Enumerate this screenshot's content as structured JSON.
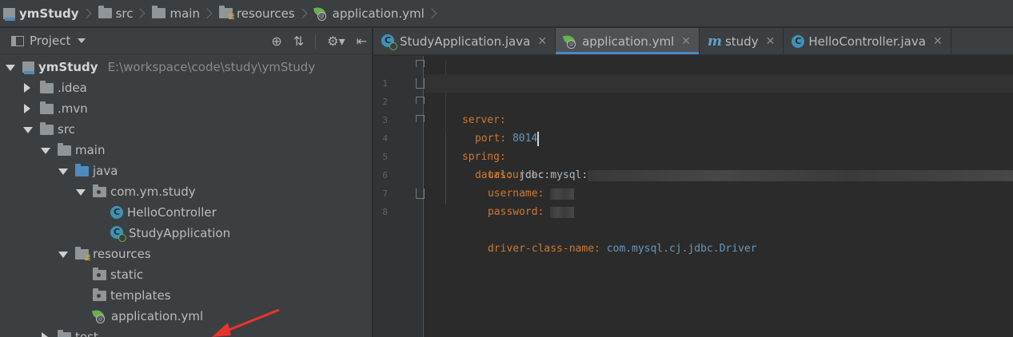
{
  "breadcrumb": [
    {
      "label": "ymStudy",
      "icon": "module-icon",
      "bold": true
    },
    {
      "label": "src",
      "icon": "folder-icon"
    },
    {
      "label": "main",
      "icon": "folder-icon"
    },
    {
      "label": "resources",
      "icon": "resources-folder-icon"
    },
    {
      "label": "application.yml",
      "icon": "spring-yml-icon"
    }
  ],
  "project_panel": {
    "title": "Project",
    "tools": [
      "locate-icon",
      "collapse-icon",
      "settings-icon",
      "hide-icon"
    ]
  },
  "tree": [
    {
      "label": "ymStudy",
      "path": "E:\\workspace\\code\\study\\ymStudy",
      "depth": 0,
      "expanded": true,
      "icon": "module-icon",
      "bold": true
    },
    {
      "label": ".idea",
      "depth": 1,
      "expanded": false,
      "icon": "folder-icon"
    },
    {
      "label": ".mvn",
      "depth": 1,
      "expanded": false,
      "icon": "folder-icon"
    },
    {
      "label": "src",
      "depth": 1,
      "expanded": true,
      "icon": "folder-icon"
    },
    {
      "label": "main",
      "depth": 2,
      "expanded": true,
      "icon": "folder-icon"
    },
    {
      "label": "java",
      "depth": 3,
      "expanded": true,
      "icon": "source-folder-icon"
    },
    {
      "label": "com.ym.study",
      "depth": 4,
      "expanded": true,
      "icon": "package-icon"
    },
    {
      "label": "HelloController",
      "depth": 5,
      "icon": "class-icon"
    },
    {
      "label": "StudyApplication",
      "depth": 5,
      "icon": "spring-boot-class-icon"
    },
    {
      "label": "resources",
      "depth": 3,
      "expanded": true,
      "icon": "resources-folder-icon"
    },
    {
      "label": "static",
      "depth": 4,
      "icon": "folder-icon"
    },
    {
      "label": "templates",
      "depth": 4,
      "icon": "folder-icon"
    },
    {
      "label": "application.yml",
      "depth": 4,
      "icon": "spring-yml-icon"
    },
    {
      "label": "test",
      "depth": 2,
      "expanded": false,
      "icon": "folder-icon"
    }
  ],
  "tabs": [
    {
      "label": "StudyApplication.java",
      "icon": "spring-boot-class-icon",
      "active": false
    },
    {
      "label": "application.yml",
      "icon": "spring-yml-icon",
      "active": true
    },
    {
      "label": "study",
      "icon": "maven-icon",
      "active": false
    },
    {
      "label": "HelloController.java",
      "icon": "class-icon",
      "active": false
    }
  ],
  "code_lines": [
    {
      "n": "1",
      "key": "server:",
      "value": "",
      "indent": 0
    },
    {
      "n": "2",
      "key": "port:",
      "value": "8014",
      "indent": 1,
      "current": true
    },
    {
      "n": "3",
      "key": "spring:",
      "value": "",
      "indent": 0
    },
    {
      "n": "4",
      "key": "datasource:",
      "value": "",
      "indent": 1
    },
    {
      "n": "5",
      "key": "url:",
      "value": "jdbc:mysql:",
      "indent": 2,
      "blurred": true
    },
    {
      "n": "6",
      "key": "username:",
      "value": "",
      "indent": 2,
      "blurred": true
    },
    {
      "n": "7",
      "key": "password:",
      "value": "",
      "indent": 2,
      "blurred": true
    },
    {
      "n": "8",
      "key": "driver-class-name:",
      "value": "com.mysql.cj.jdbc.Driver",
      "indent": 2
    }
  ],
  "colors": {
    "key": "#cc7832",
    "string": "#6a8759",
    "number": "#6897bb",
    "active_tab_underline": "#4a88c7",
    "annotation_arrow": "#e8342c"
  }
}
